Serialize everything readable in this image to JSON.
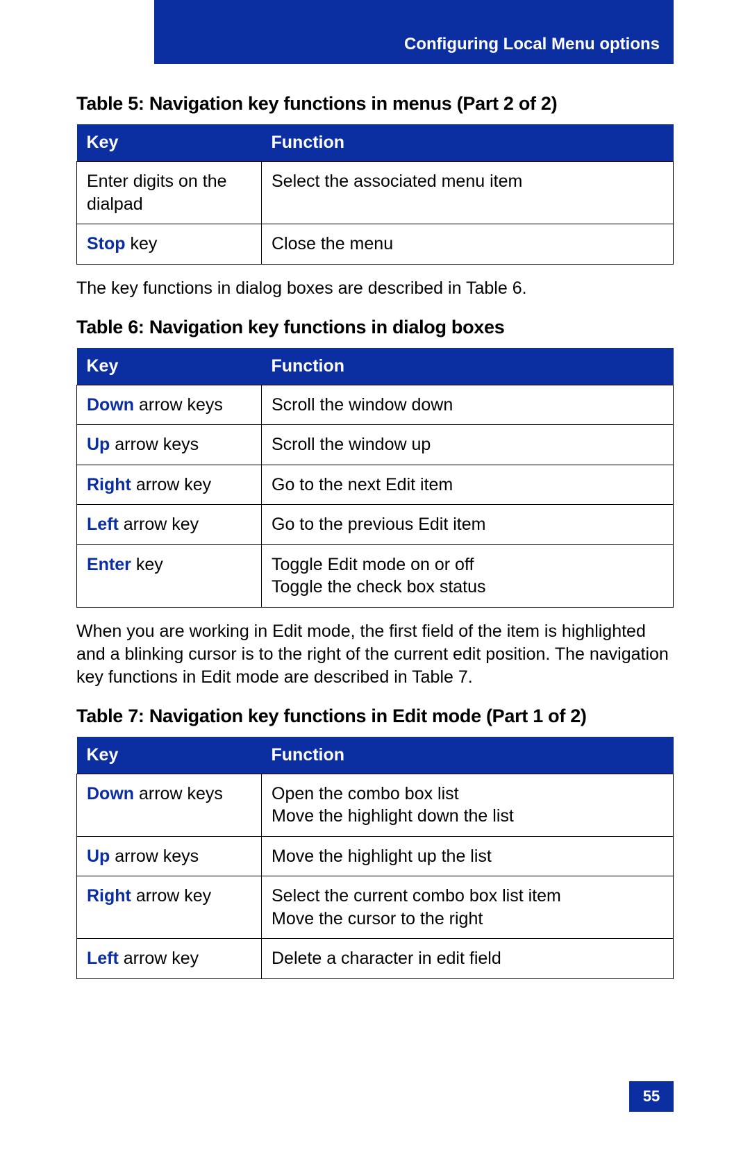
{
  "header": {
    "section_title": "Configuring Local Menu options"
  },
  "page_number": "55",
  "table5": {
    "caption": "Table 5: Navigation key functions in menus (Part 2 of 2)",
    "head": {
      "key": "Key",
      "func": "Function"
    },
    "rows": [
      {
        "key_bold": "",
        "key_plain": "Enter digits on the dialpad",
        "func": "Select the associated menu item"
      },
      {
        "key_bold": "Stop",
        "key_plain": " key",
        "func": "Close the menu"
      }
    ]
  },
  "para1": "The key functions in dialog boxes are described in Table 6.",
  "table6": {
    "caption": "Table 6: Navigation key functions in dialog boxes",
    "head": {
      "key": "Key",
      "func": "Function"
    },
    "rows": [
      {
        "key_bold": "Down",
        "key_plain": " arrow keys",
        "func": "Scroll the window down"
      },
      {
        "key_bold": "Up",
        "key_plain": " arrow keys",
        "func": "Scroll the window up"
      },
      {
        "key_bold": "Right",
        "key_plain": " arrow key",
        "func": "Go to the next Edit item"
      },
      {
        "key_bold": "Left",
        "key_plain": " arrow key",
        "func": "Go to the previous Edit item"
      },
      {
        "key_bold": "Enter",
        "key_plain": " key",
        "func": "Toggle Edit mode on or off\nToggle the check box status"
      }
    ]
  },
  "para2": "When you are working in Edit mode, the first field of the item is highlighted and a blinking cursor is to the right of the current edit position. The navigation key functions in Edit mode are described in Table 7.",
  "table7": {
    "caption": "Table 7: Navigation key functions in Edit mode (Part 1 of 2)",
    "head": {
      "key": "Key",
      "func": "Function"
    },
    "rows": [
      {
        "key_bold": "Down",
        "key_plain": " arrow keys",
        "func": "Open the combo box list\nMove the highlight down the list"
      },
      {
        "key_bold": "Up",
        "key_plain": " arrow keys",
        "func": "Move the highlight up the list"
      },
      {
        "key_bold": "Right",
        "key_plain": " arrow key",
        "func": "Select the current combo box list item\nMove the cursor to the right"
      },
      {
        "key_bold": "Left",
        "key_plain": " arrow key",
        "func": "Delete a character in edit field"
      }
    ]
  }
}
